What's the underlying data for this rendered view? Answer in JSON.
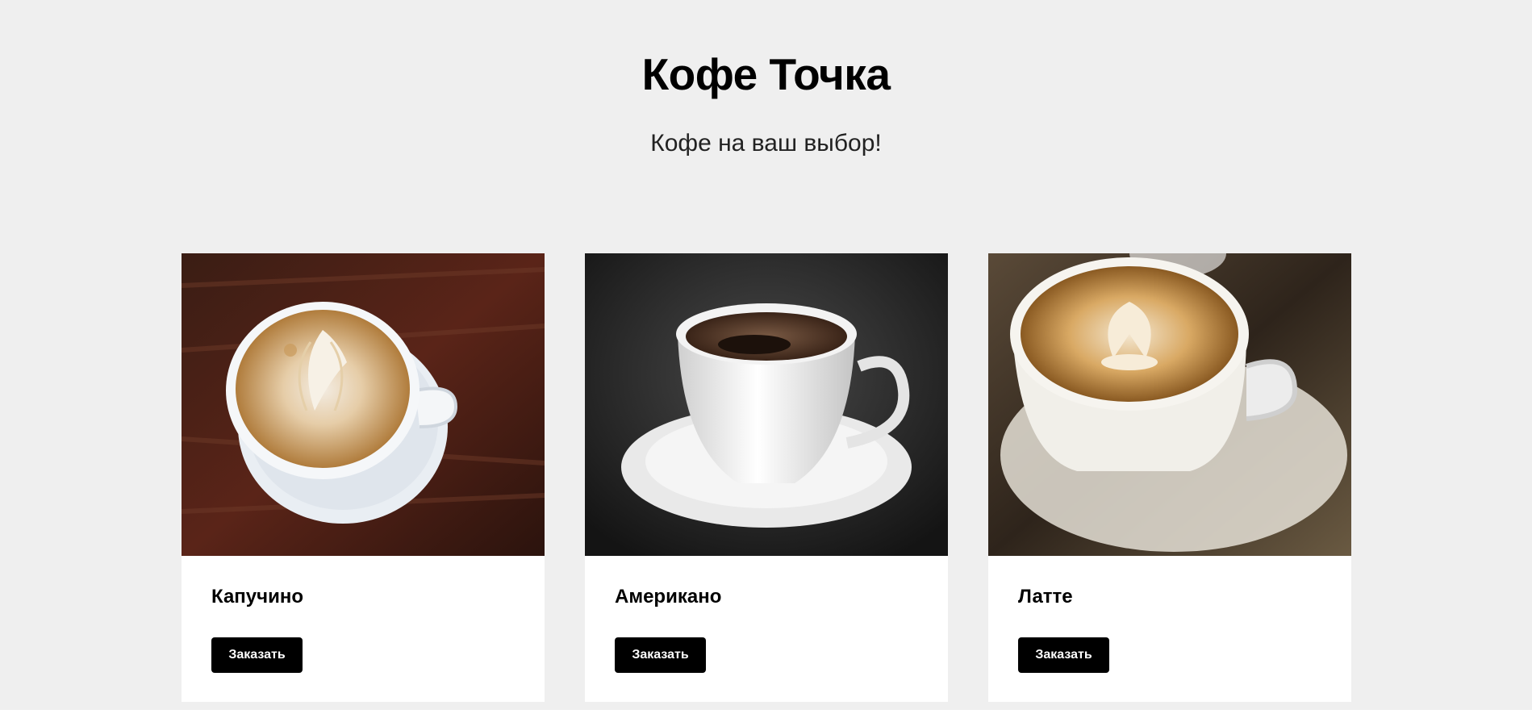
{
  "hero": {
    "title": "Кофе Точка",
    "subtitle": "Кофе на ваш выбор!"
  },
  "products": [
    {
      "name": "Капучино",
      "button_label": "Заказать",
      "image_alt": "cappuccino-photo"
    },
    {
      "name": "Американо",
      "button_label": "Заказать",
      "image_alt": "americano-photo"
    },
    {
      "name": "Латте",
      "button_label": "Заказать",
      "image_alt": "latte-photo"
    }
  ],
  "colors": {
    "page_background": "#efefef",
    "card_background": "#ffffff",
    "button_background": "#000000",
    "button_text": "#ffffff"
  }
}
